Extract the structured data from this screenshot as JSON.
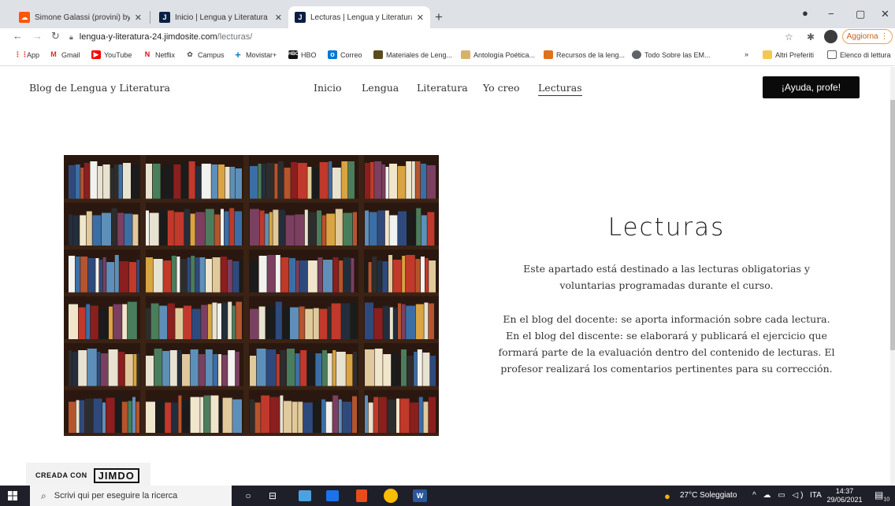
{
  "browser": {
    "tabs": [
      {
        "title": "Simone Galassi (provini) by Dotti",
        "favicon": "soundcloud-icon",
        "active": false
      },
      {
        "title": "Inicio | Lengua y Literatura",
        "favicon": "jimdo-icon",
        "active": false
      },
      {
        "title": "Lecturas | Lengua y Literatura",
        "favicon": "jimdo-icon",
        "active": true
      }
    ],
    "new_tab": "+",
    "url_domain": "lengua-y-literatura-24.jimdosite.com",
    "url_path": "/lecturas/",
    "update_label": "Aggiorna",
    "bookmarks": [
      {
        "label": "App",
        "icon": "apps-icon",
        "color": "#ea4335"
      },
      {
        "label": "Gmail",
        "icon": "gmail-icon",
        "color": "#d93025"
      },
      {
        "label": "YouTube",
        "icon": "youtube-icon",
        "color": "#ff0000"
      },
      {
        "label": "Netflix",
        "icon": "netflix-icon",
        "color": "#e50914"
      },
      {
        "label": "Campus",
        "icon": "campus-icon",
        "color": "#4a4a4a"
      },
      {
        "label": "Movistar+",
        "icon": "movistar-icon",
        "color": "#0b7fca"
      },
      {
        "label": "HBO",
        "icon": "hbo-icon",
        "color": "#111111"
      },
      {
        "label": "Correo",
        "icon": "mail-icon",
        "color": "#0078d4"
      },
      {
        "label": "Materiales de Leng...",
        "icon": "bookmark-icon",
        "color": "#5c4a1e"
      },
      {
        "label": "Antología Poética...",
        "icon": "bookmark-icon",
        "color": "#d4b36a"
      },
      {
        "label": "Recursos de la leng...",
        "icon": "bookmark-icon",
        "color": "#e0721c"
      },
      {
        "label": "Todo Sobre las EM...",
        "icon": "globe-icon",
        "color": "#5f6368"
      }
    ],
    "bookmarks_more": "»",
    "other_bookmarks": "Altri Preferiti",
    "reading_list": "Elenco di lettura"
  },
  "site": {
    "title": "Blog de Lengua y Literatura",
    "nav": [
      {
        "label": "Inicio",
        "active": false
      },
      {
        "label": "Lengua",
        "active": false
      },
      {
        "label": "Literatura",
        "active": false
      },
      {
        "label": "Yo creo",
        "active": false
      },
      {
        "label": "Lecturas",
        "active": true
      }
    ],
    "cta": "¡Ayuda, profe!"
  },
  "content": {
    "heading": "Lecturas",
    "paragraph1": "Este apartado está destinado a las lecturas obligatorias y voluntarias programadas durante el curso.",
    "paragraph2": "En el blog del docente: se aporta información sobre cada lectura. En el blog del discente: se elaborará y publicará el ejercicio que formará parte de la evaluación dentro del contenido de lecturas. El profesor realizará los comentarios pertinentes para su corrección."
  },
  "footer": {
    "created_with": "CREADA CON",
    "brand": "JIMDO"
  },
  "taskbar": {
    "search_placeholder": "Scrivi qui per eseguire la ricerca",
    "weather": "27°C Soleggiato",
    "lang": "ITA",
    "time": "14:37",
    "date": "29/06/2021",
    "notifications": "10"
  },
  "colors": {
    "tab_bar": "#dee1e6",
    "cta_bg": "#0a0a0a",
    "update_border": "#e6a35c",
    "taskbar": "#1f1f2a"
  }
}
